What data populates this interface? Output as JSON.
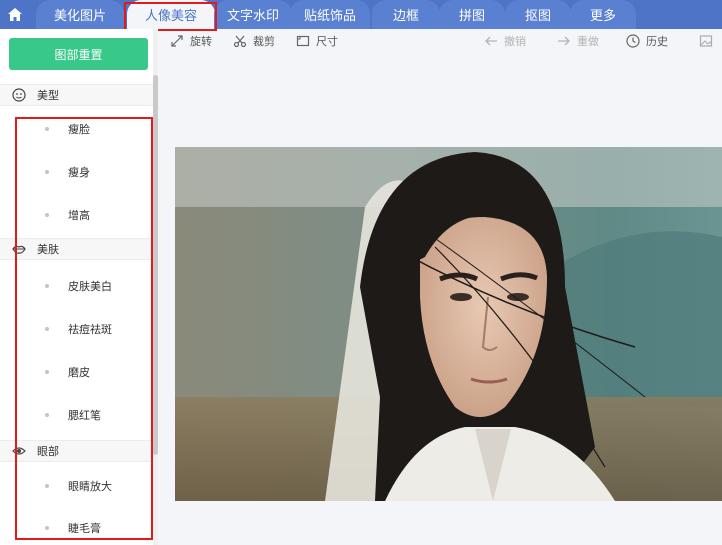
{
  "nav": {
    "tabs": [
      {
        "label": "美化图片",
        "active": false
      },
      {
        "label": "人像美容",
        "active": true
      },
      {
        "label": "文字水印",
        "active": false
      },
      {
        "label": "贴纸饰品",
        "active": false
      },
      {
        "label": "边框",
        "active": false
      },
      {
        "label": "拼图",
        "active": false
      },
      {
        "label": "抠图",
        "active": false
      },
      {
        "label": "更多",
        "active": false
      }
    ]
  },
  "sidebar": {
    "reset_label": "图部重置",
    "sections": [
      {
        "label": "美型",
        "icon": "face-icon",
        "items": [
          "瘦脸",
          "瘦身",
          "增高"
        ]
      },
      {
        "label": "美肤",
        "icon": "lips-icon",
        "items": [
          "皮肤美白",
          "祛痘祛斑",
          "磨皮",
          "腮红笔"
        ]
      },
      {
        "label": "眼部",
        "icon": "eye-icon",
        "items": [
          "眼睛放大",
          "睫毛膏"
        ]
      }
    ]
  },
  "toolbar": {
    "rotate": "旋转",
    "crop": "裁剪",
    "size": "尺寸",
    "undo": "撤销",
    "redo": "重做",
    "history": "历史"
  },
  "colors": {
    "nav_bg": "#4d74c6",
    "accent_green": "#37c88a",
    "highlight_red": "#e01b1b"
  }
}
